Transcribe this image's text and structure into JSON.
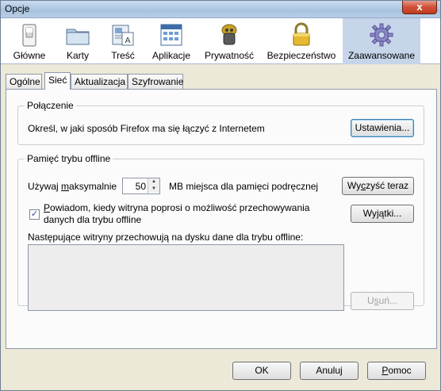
{
  "window": {
    "title": "Opcje",
    "close_label": "x"
  },
  "toolbar": {
    "panes": [
      {
        "label": "Główne",
        "icon": "switch-icon"
      },
      {
        "label": "Karty",
        "icon": "tabs-folder-icon"
      },
      {
        "label": "Treść",
        "icon": "content-page-icon"
      },
      {
        "label": "Aplikacje",
        "icon": "applications-icon"
      },
      {
        "label": "Prywatność",
        "icon": "privacy-mask-icon"
      },
      {
        "label": "Bezpieczeństwo",
        "icon": "padlock-icon"
      },
      {
        "label": "Zaawansowane",
        "icon": "gear-icon",
        "selected": true
      }
    ]
  },
  "tabs": [
    {
      "label": "Ogólne"
    },
    {
      "label": "Sieć",
      "active": true
    },
    {
      "label": "Aktualizacja"
    },
    {
      "label": "Szyfrowanie"
    }
  ],
  "connection": {
    "legend": "Połączenie",
    "description": "Określ, w jaki sposób Firefox ma się łączyć z Internetem",
    "settings_button": "Ustawienia..."
  },
  "offline": {
    "legend": "Pamięć trybu offline",
    "use_prefix": "Używaj ",
    "use_accel": "m",
    "use_rest": "aksymalnie",
    "max_value": "50",
    "unit_text": "MB miejsca dla pamięci podręcznej",
    "clear_button_pre": "Wy",
    "clear_button_accel": "c",
    "clear_button_post": "zyść teraz",
    "notify_checked": true,
    "notify_accel": "P",
    "notify_line1_rest": "owiadom, kiedy witryna poprosi o możliwość przechowywania",
    "notify_line2": "danych dla trybu offline",
    "exceptions_button_pre": "Wy",
    "exceptions_button_accel": "j",
    "exceptions_button_post": "ątki...",
    "list_label": "Następujące witryny przechowują na dysku dane dla trybu offline:",
    "remove_button_pre": "U",
    "remove_button_accel": "s",
    "remove_button_post": "uń..."
  },
  "footer": {
    "ok_label": "OK",
    "cancel_label": "Anuluj",
    "help_accel": "P",
    "help_rest": "omoc"
  },
  "colors": {
    "selected_pane": "#c6d5ea",
    "dialog_background": "#ece9d8",
    "checkmark": "#2a4ea0"
  }
}
